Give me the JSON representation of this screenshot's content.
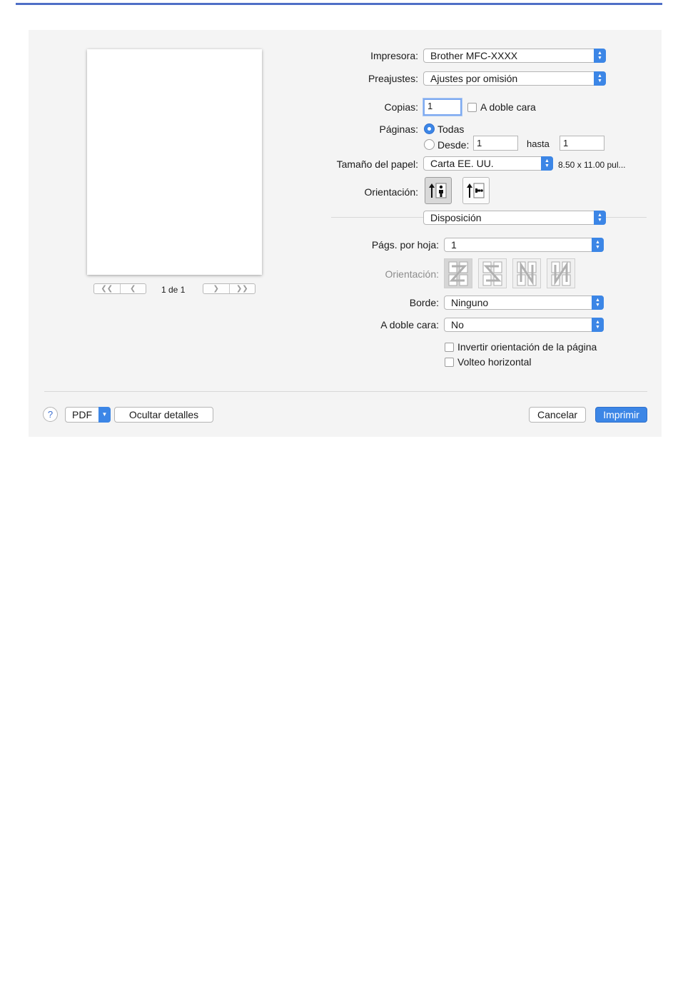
{
  "preview": {
    "page_count": "1 de 1",
    "nav": [
      "first-page-icon",
      "prev-page-icon",
      "next-page-icon",
      "last-page-icon"
    ]
  },
  "printer": {
    "label": "Impresora:",
    "value": "Brother MFC-XXXX"
  },
  "presets": {
    "label": "Preajustes:",
    "value": "Ajustes por omisión"
  },
  "copies": {
    "label": "Copias:",
    "value": "1",
    "duplex_label": "A doble cara",
    "duplex_checked": false
  },
  "pages": {
    "label": "Páginas:",
    "all_label": "Todas",
    "from_label": "Desde:",
    "from_value": "1",
    "to_label": "hasta",
    "to_value": "1",
    "selected": "all"
  },
  "paper_size": {
    "label": "Tamaño del papel:",
    "value": "Carta EE. UU.",
    "dimensions": "8.50 x 11.00 pul..."
  },
  "orientation": {
    "label": "Orientación:",
    "options": [
      "portrait-icon",
      "landscape-icon"
    ],
    "selected": "portrait-icon"
  },
  "section": {
    "value": "Disposición"
  },
  "layout": {
    "pages_per_sheet": {
      "label": "Págs. por hoja:",
      "value": "1"
    },
    "direction": {
      "label": "Orientación:",
      "options": [
        "layout-z-icon",
        "layout-s-icon",
        "layout-n-reverse-icon",
        "layout-n-icon"
      ]
    },
    "border": {
      "label": "Borde:",
      "value": "Ninguno"
    },
    "two_sided": {
      "label": "A doble cara:",
      "value": "No"
    },
    "reverse_orientation": {
      "label": "Invertir orientación de la página",
      "checked": false
    },
    "flip_horizontal": {
      "label": "Volteo horizontal",
      "checked": false
    }
  },
  "footer": {
    "help": "?",
    "pdf": "PDF",
    "hide_details": "Ocultar detalles",
    "cancel": "Cancelar",
    "print": "Imprimir"
  },
  "colors": {
    "accent": "#3c86e6",
    "top_rule": "#4f6fc7",
    "dialog_bg": "#f4f4f4"
  }
}
